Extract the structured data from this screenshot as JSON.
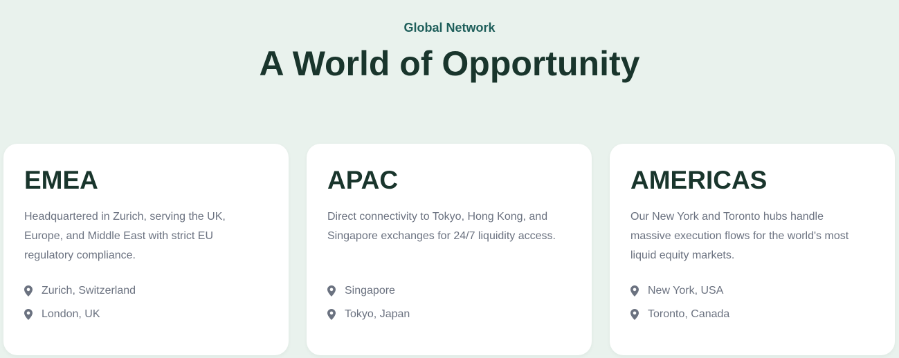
{
  "section": {
    "eyebrow": "Global Network",
    "title": "A World of Opportunity"
  },
  "colors": {
    "background": "#e9f2ed",
    "eyebrow": "#1f5f5b",
    "heading": "#19352c",
    "body_text": "#6b7280",
    "card": "#ffffff"
  },
  "cards": [
    {
      "region": "EMEA",
      "description": "Headquartered in Zurich, serving the UK, Europe, and Middle East with strict EU regulatory compliance.",
      "locations": [
        {
          "icon": "map-pin-icon",
          "label": "Zurich, Switzerland"
        },
        {
          "icon": "map-pin-icon",
          "label": "London, UK"
        }
      ]
    },
    {
      "region": "APAC",
      "description": "Direct connectivity to Tokyo, Hong Kong, and Singapore exchanges for 24/7 liquidity access.",
      "locations": [
        {
          "icon": "map-pin-icon",
          "label": "Singapore"
        },
        {
          "icon": "map-pin-icon",
          "label": "Tokyo, Japan"
        }
      ]
    },
    {
      "region": "AMERICAS",
      "description": "Our New York and Toronto hubs handle massive execution flows for the world's most liquid equity markets.",
      "locations": [
        {
          "icon": "map-pin-icon",
          "label": "New York, USA"
        },
        {
          "icon": "map-pin-icon",
          "label": "Toronto, Canada"
        }
      ]
    }
  ]
}
